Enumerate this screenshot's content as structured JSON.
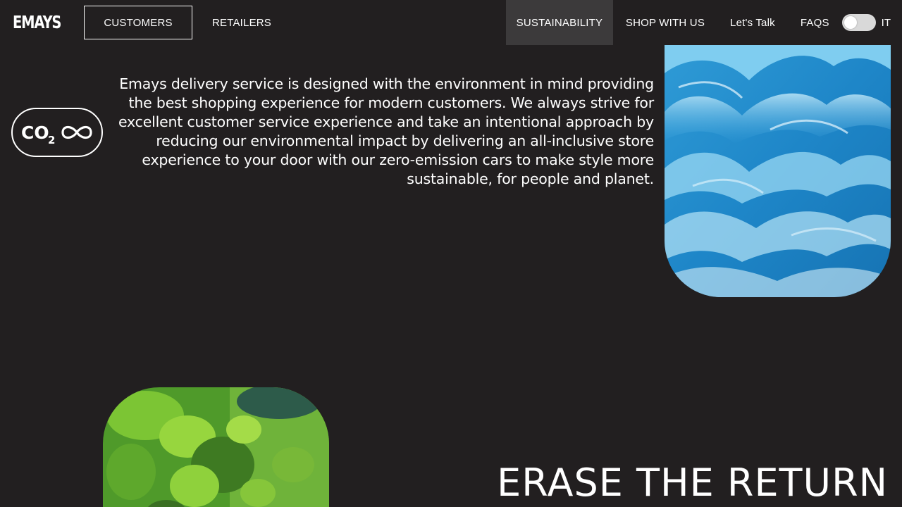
{
  "header": {
    "logo": "EMAYS",
    "nav_left": [
      {
        "label": "CUSTOMERS"
      },
      {
        "label": "RETAILERS"
      }
    ],
    "nav_right": [
      {
        "label": "SUSTAINABILITY"
      },
      {
        "label": "SHOP WITH US"
      },
      {
        "label": "Let's Talk"
      },
      {
        "label": "FAQS"
      }
    ],
    "language": "IT"
  },
  "badge": {
    "co2_text": "CO",
    "co2_subscript": "2"
  },
  "intro": {
    "text": "Emays delivery service is designed with the environment in mind providing the best shopping experience for modern customers. We always strive for excellent customer service experience and take an intentional approach by reducing our environmental impact by delivering an all-inclusive store experience to your door with our zero-emission cars to make style more sustainable, for people and planet."
  },
  "section": {
    "heading": "ERASE THE RETURN"
  },
  "colors": {
    "background": "#221f20",
    "active_nav": "#3c3a3b",
    "text": "#ffffff"
  }
}
